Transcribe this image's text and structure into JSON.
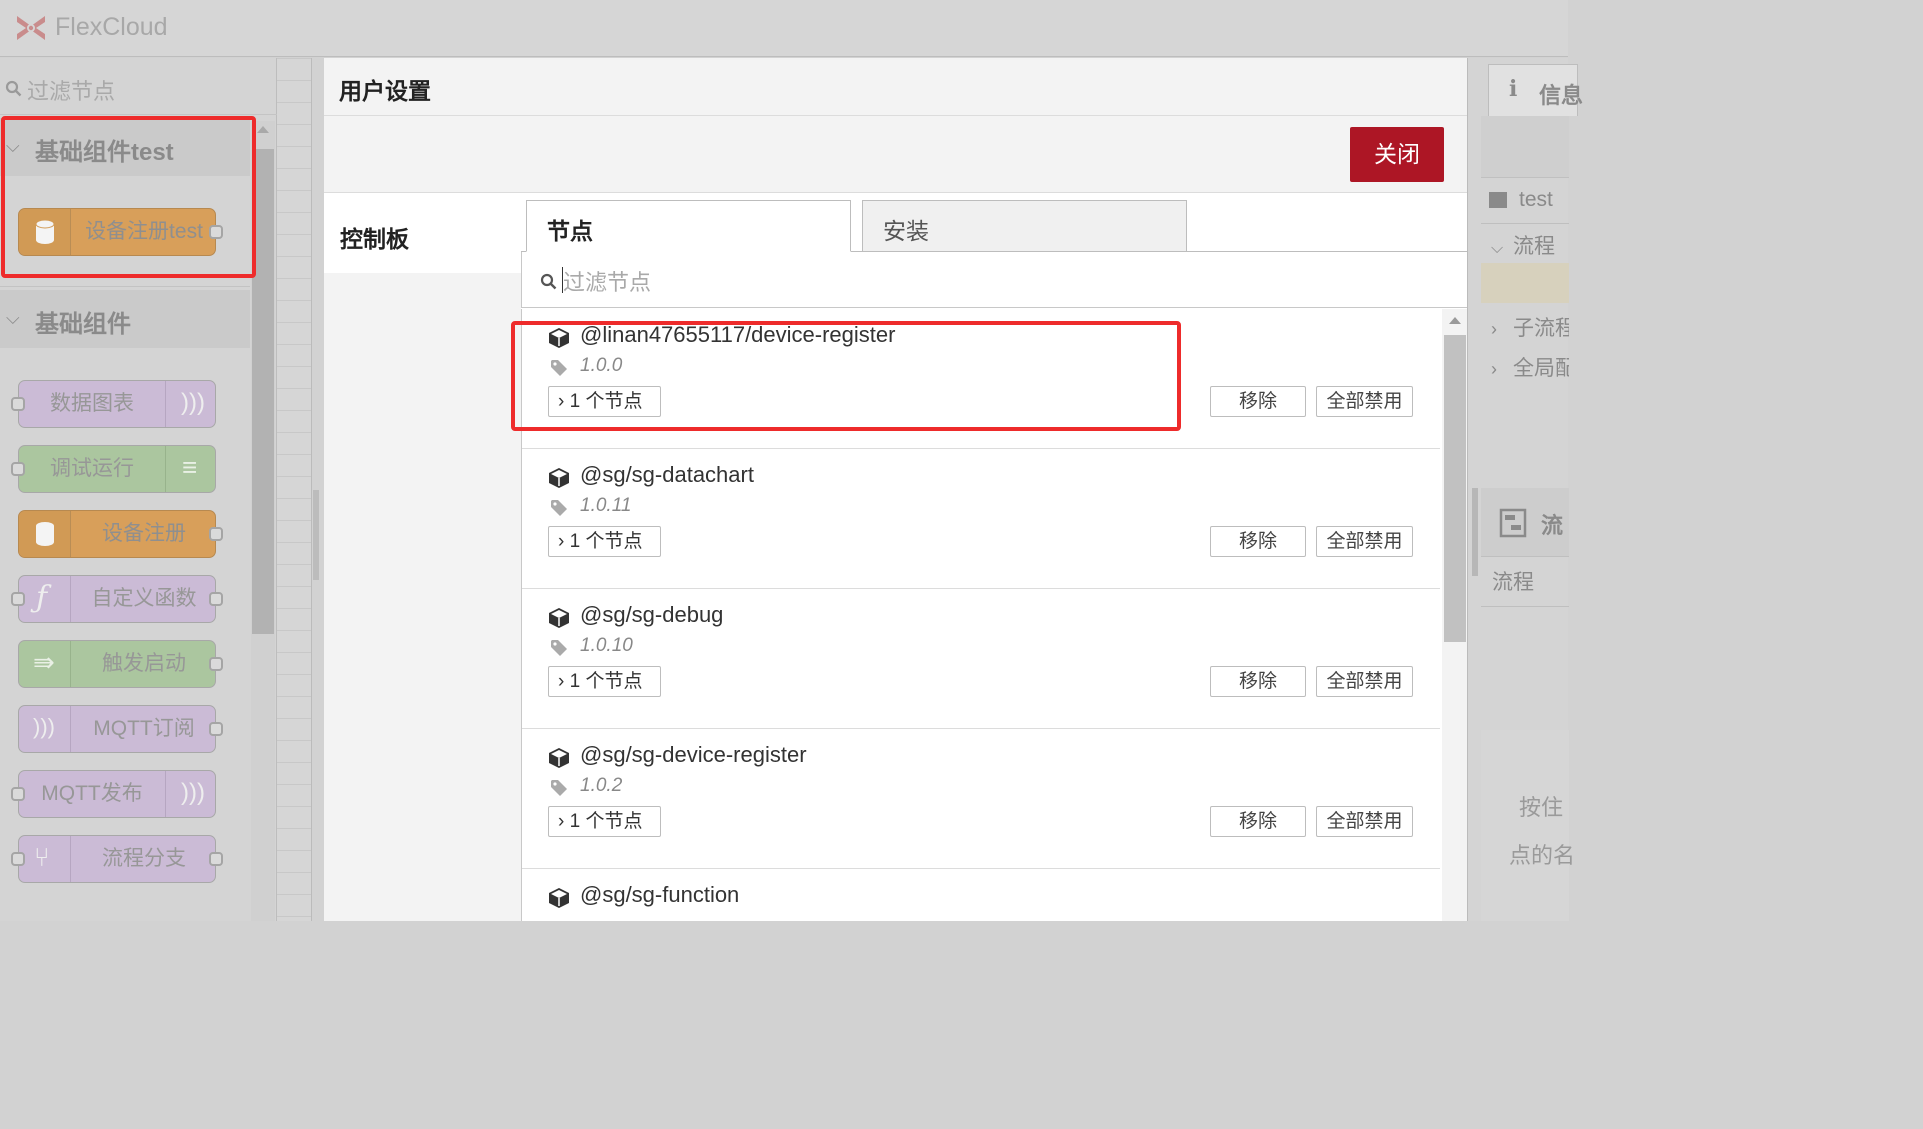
{
  "app": {
    "brand": "FlexCloud"
  },
  "palette": {
    "search_placeholder": "过滤节点",
    "categories": [
      {
        "label": "基础组件test",
        "nodes": [
          {
            "label": "设备注册test",
            "color": "#d89f5a"
          }
        ]
      },
      {
        "label": "基础组件",
        "nodes": [
          {
            "label": "数据图表",
            "color": "#c9b8d6"
          },
          {
            "label": "调试运行",
            "color": "#a9c49c"
          },
          {
            "label": "设备注册",
            "color": "#d89f5a"
          },
          {
            "label": "自定义函数",
            "color": "#c9b8d6"
          },
          {
            "label": "触发启动",
            "color": "#a9c49c"
          },
          {
            "label": "MQTT订阅",
            "color": "#c9b8d6"
          },
          {
            "label": "MQTT发布",
            "color": "#c9b8d6"
          },
          {
            "label": "流程分支",
            "color": "#c9b8d6"
          }
        ]
      }
    ]
  },
  "dialog": {
    "title": "用户设置",
    "close_label": "关闭",
    "side_nav": {
      "active": "控制板"
    },
    "tabs": [
      "节点",
      "安装"
    ],
    "filter_placeholder": "过滤节点",
    "packages": [
      {
        "name": "@linan47655117/device-register",
        "version": "1.0.0",
        "count": "1 个节点"
      },
      {
        "name": "@sg/sg-datachart",
        "version": "1.0.11",
        "count": "1 个节点"
      },
      {
        "name": "@sg/sg-debug",
        "version": "1.0.10",
        "count": "1 个节点"
      },
      {
        "name": "@sg/sg-device-register",
        "version": "1.0.2",
        "count": "1 个节点"
      },
      {
        "name": "@sg/sg-function",
        "version": "",
        "count": ""
      }
    ],
    "remove_label": "移除",
    "disable_all_label": "全部禁用"
  },
  "sidebar": {
    "info_tab": "信息",
    "items": [
      "test",
      "流程",
      "子流程",
      "全局配置"
    ],
    "section2_label": "流程",
    "hint": "按住Ctrl键点击节点的名称",
    "hint_lines": [
      "按住",
      "点的名"
    ]
  },
  "colors": {
    "accent": "#ad1625",
    "highlight": "#ee2b2b"
  }
}
